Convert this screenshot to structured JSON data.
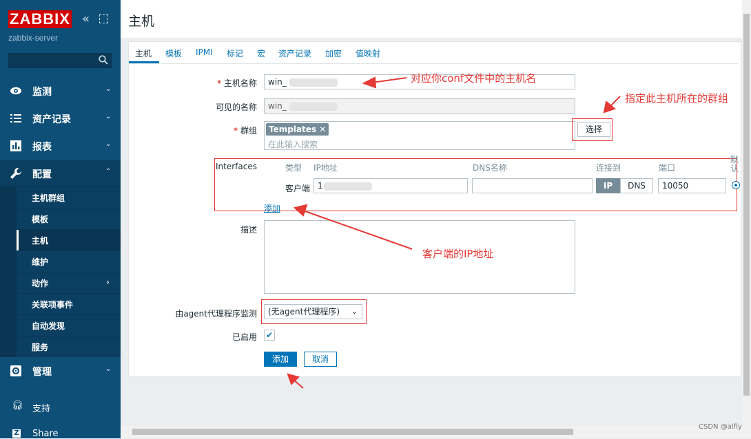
{
  "app": {
    "logo": "ZABBIX",
    "server_name": "zabbix-server"
  },
  "page_title": "主机",
  "sidebar": {
    "menu": [
      {
        "label": "监测",
        "icon": "eye-icon"
      },
      {
        "label": "资产记录",
        "icon": "list-icon"
      },
      {
        "label": "报表",
        "icon": "bar-chart-icon"
      },
      {
        "label": "配置",
        "icon": "wrench-icon"
      },
      {
        "label": "管理",
        "icon": "gear-icon"
      }
    ],
    "config_items": [
      {
        "label": "主机群组"
      },
      {
        "label": "模板"
      },
      {
        "label": "主机"
      },
      {
        "label": "维护"
      },
      {
        "label": "动作"
      },
      {
        "label": "关联项事件"
      },
      {
        "label": "自动发现"
      },
      {
        "label": "服务"
      }
    ],
    "support_label": "支持",
    "share_label": "Share"
  },
  "tabs": [
    "主机",
    "模板",
    "IPMI",
    "标记",
    "宏",
    "资产记录",
    "加密",
    "值映射"
  ],
  "form": {
    "host_name_label": "主机名称",
    "host_name_value": "win_",
    "visible_name_label": "可见的名称",
    "visible_name_value": "win_",
    "groups_label": "群组",
    "group_tag": "Templates",
    "groups_placeholder": "在此输入搜索",
    "select_button": "选择",
    "interfaces_label": "Interfaces",
    "interfaces_columns": {
      "type": "类型",
      "ip": "IP地址",
      "dns": "DNS名称",
      "connect": "连接到",
      "port": "端口",
      "default": "默认"
    },
    "interface_row": {
      "type": "客户端",
      "ip_value": "1",
      "dns_value": "",
      "ip_toggle": "IP",
      "dns_toggle": "DNS",
      "port": "10050"
    },
    "add_interface_link": "添加",
    "description_label": "描述",
    "proxy_label": "由agent代理程序监测",
    "proxy_value": "(无agent代理程序)",
    "enabled_label": "已启用",
    "add_button": "添加",
    "cancel_button": "取消"
  },
  "annotations": {
    "host_name": "对应你conf文件中的主机名",
    "group": "指定此主机所在的群组",
    "client_ip": "客户端的IP地址"
  },
  "watermark": "CSDN @alfiy",
  "colors": {
    "sidebar": "#0e4f78",
    "accent": "#0275b8",
    "logo": "#d40000",
    "annotation": "#e53935"
  }
}
